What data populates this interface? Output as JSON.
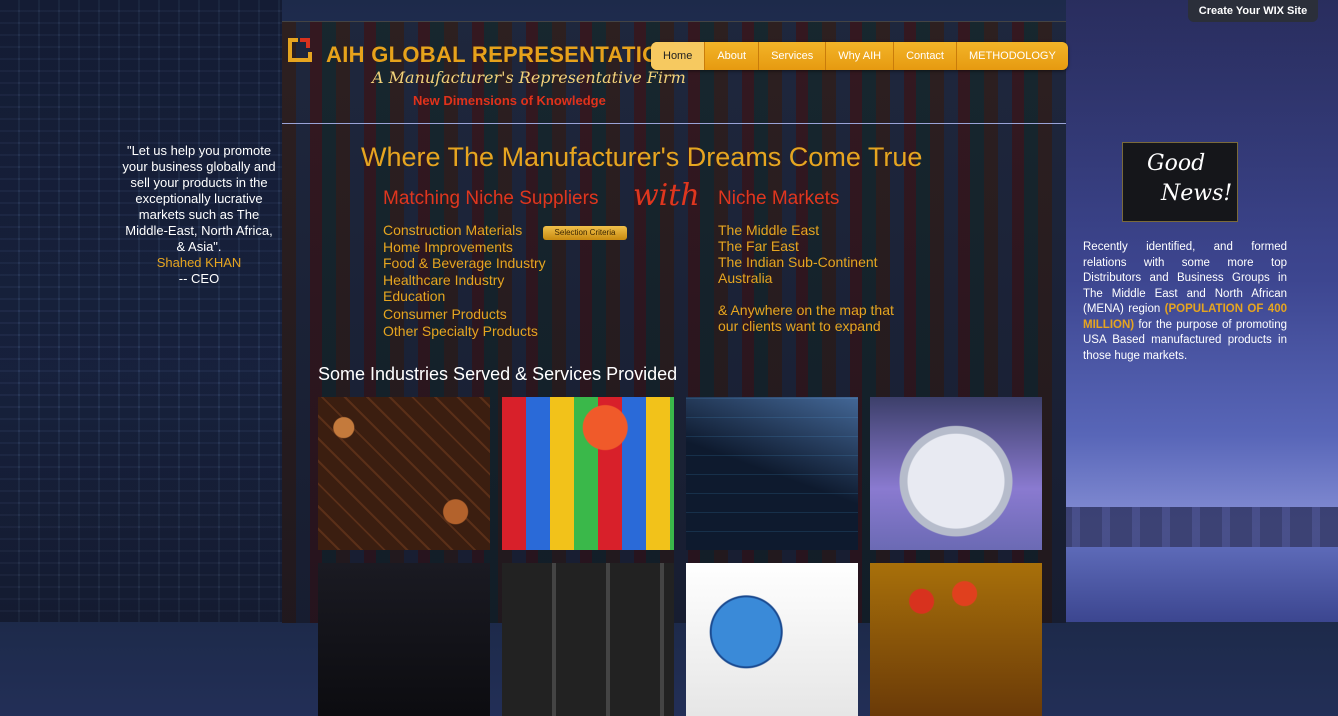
{
  "wix_badge": {
    "text": "Create Your WIX Site"
  },
  "brand": {
    "title": "AIH GLOBAL REPRESENTATION",
    "subtitle": "A Manufacturer's Representative Firm",
    "tagline": "New Dimensions of Knowledge"
  },
  "nav": {
    "items": [
      {
        "label": "Home",
        "active": true
      },
      {
        "label": "About"
      },
      {
        "label": "Services"
      },
      {
        "label": "Why AIH"
      },
      {
        "label": "Contact"
      },
      {
        "label": "METHODOLOGY"
      }
    ]
  },
  "hero": {
    "headline": "Where The Manufacturer's Dreams Come True",
    "left_heading": "Matching Niche Suppliers",
    "with_word": "with",
    "right_heading": "Niche Markets",
    "selection_criteria": "Selection Criteria",
    "suppliers": [
      "Construction Materials",
      "Home Improvements",
      "Food & Beverage Industry",
      "Healthcare Industry",
      "Education",
      "Consumer Products",
      "Other Specialty Products"
    ],
    "markets": [
      "The Middle East",
      "The Far East",
      "The Indian Sub-Continent",
      "Australia"
    ],
    "markets_note_1": "& Anywhere on the map that",
    "markets_note_2": "our clients want to expand"
  },
  "industries": {
    "title": "Some Industries Served & Services Provided",
    "tiles": [
      {
        "name": "chocolate"
      },
      {
        "name": "toys"
      },
      {
        "name": "business-chart"
      },
      {
        "name": "machinery"
      },
      {
        "name": "building"
      },
      {
        "name": "keyboard"
      },
      {
        "name": "globe-books"
      },
      {
        "name": "food"
      }
    ]
  },
  "quote": {
    "text": "\"Let us help you promote your business globally and sell your products in the exceptionally lucrative markets such as The Middle-East, North Africa, & Asia\".",
    "author": "Shahed KHAN",
    "role": "-- CEO"
  },
  "news": {
    "badge_line1": "Good",
    "badge_line2": "News!",
    "text_before": "Recently identified, and formed relations with some more top Distributors and Business Groups in The Middle East and North African (MENA) region ",
    "highlight": "(POPULATION OF 400 MILLION)",
    "text_after": " for the purpose of promoting USA Based manufactured products in those huge markets."
  },
  "colors": {
    "accent_orange": "#e6a520",
    "accent_red": "#e0361e",
    "nav_bg": "#e69a10"
  }
}
